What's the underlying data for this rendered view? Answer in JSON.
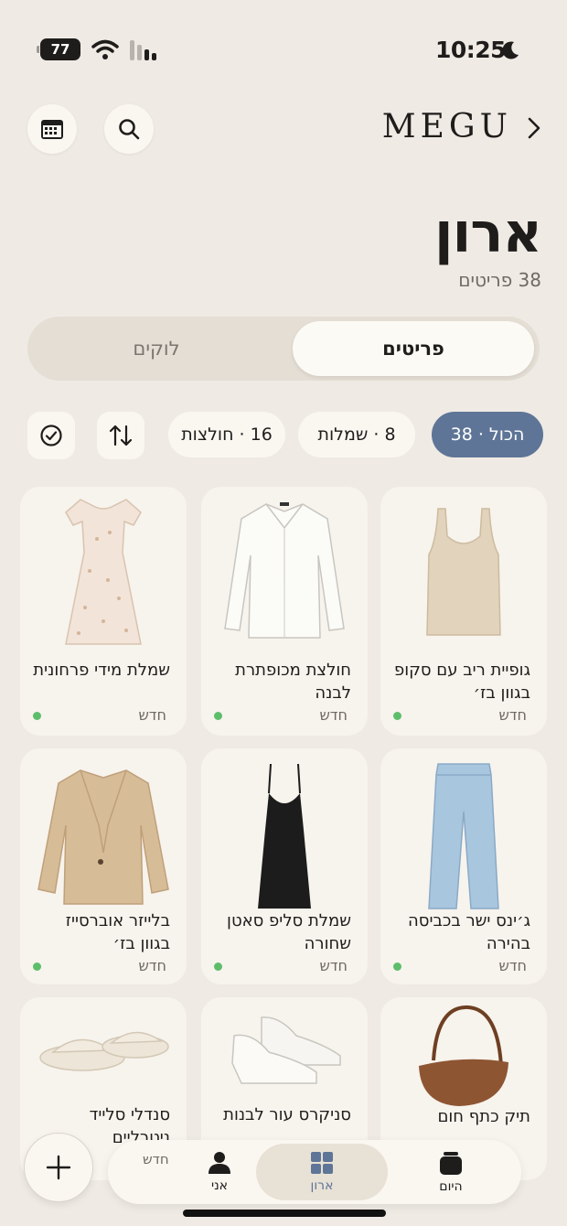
{
  "status_bar": {
    "time": "10:25",
    "battery": "77"
  },
  "header": {
    "brand": "MEGU"
  },
  "page": {
    "title": "ארון",
    "subtitle": "38 פריטים"
  },
  "tabs": [
    {
      "label": "פריטים",
      "active": true
    },
    {
      "label": "לוקים",
      "active": false
    }
  ],
  "filters": [
    {
      "label": "הכול · 38",
      "active": true
    },
    {
      "label": "8 · שמלות",
      "active": false
    },
    {
      "label": "16 · חולצות",
      "active": false
    }
  ],
  "items": [
    {
      "name": "גופיית ריב עם סקופ בגוון בז׳",
      "status": "חדש",
      "icon": "tank-top-icon",
      "color": "#E2D3BC"
    },
    {
      "name": "חולצת מכופתרת לבנה",
      "status": "חדש",
      "icon": "shirt-icon",
      "color": "#FBFBF8"
    },
    {
      "name": "שמלת מידי פרחונית",
      "status": "חדש",
      "icon": "floral-dress-icon",
      "color": "#F2E4D8"
    },
    {
      "name": "ג׳ינס ישר בכביסה בהירה",
      "status": "חדש",
      "icon": "jeans-icon",
      "color": "#A9C6DF"
    },
    {
      "name": "שמלת סליפ סאטן שחורה",
      "status": "חדש",
      "icon": "slip-dress-icon",
      "color": "#1C1C1C"
    },
    {
      "name": "בלייזר אוברסייז בגוון בז׳",
      "status": "חדש",
      "icon": "blazer-icon",
      "color": "#D7BC98"
    },
    {
      "name": "תיק כתף חום",
      "status": "",
      "icon": "shoulder-bag-icon",
      "color": "#8E5532"
    },
    {
      "name": "סניקרס עור לבנות",
      "status": "",
      "icon": "sneakers-icon",
      "color": "#F6F5F2"
    },
    {
      "name": "סנדלי סלייד ניטרליים",
      "status": "חדש",
      "icon": "slides-icon",
      "color": "#EDE5D7"
    }
  ],
  "nav": [
    {
      "label": "היום",
      "icon": "today-icon"
    },
    {
      "label": "ארון",
      "icon": "closet-grid-icon",
      "active": true
    },
    {
      "label": "אני",
      "icon": "person-icon"
    }
  ],
  "colors": {
    "accent": "#5E7597",
    "background": "#EFEAE4",
    "new_dot": "#5DBE6A"
  }
}
